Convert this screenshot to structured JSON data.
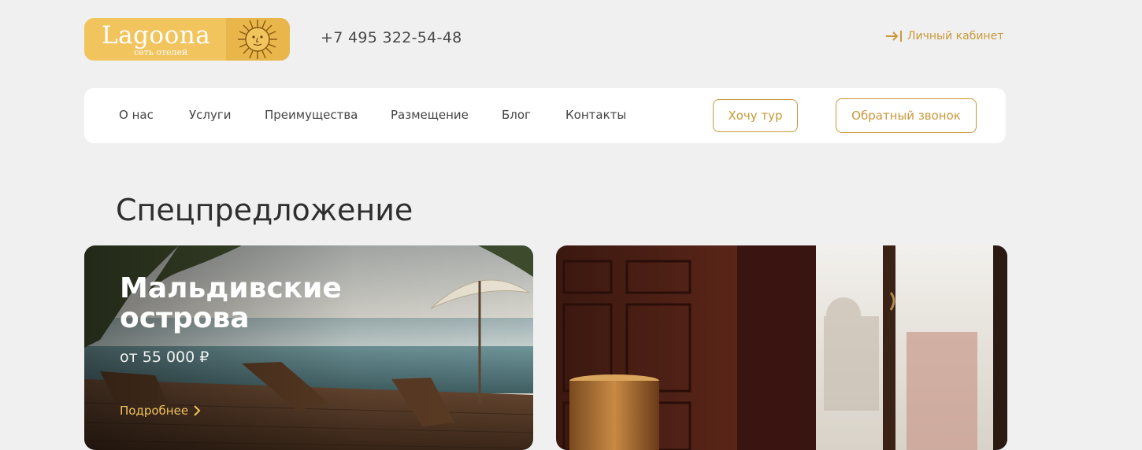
{
  "header": {
    "logo_text": "Lagoona",
    "logo_subtitle": "сеть отелей",
    "phone": "+7 495 322-54-48",
    "account_label": "Личный кабинет"
  },
  "nav": {
    "items": [
      {
        "label": "О нас"
      },
      {
        "label": "Услуги"
      },
      {
        "label": "Преимущества"
      },
      {
        "label": "Размещение"
      },
      {
        "label": "Блог"
      },
      {
        "label": "Контакты"
      }
    ],
    "tour_button": "Хочу тур",
    "callback_button": "Обратный звонок"
  },
  "special": {
    "title": "Спецпредложение",
    "cards": [
      {
        "title": "Мальдивские острова",
        "price": "от 55 000 ₽",
        "more": "Подробнее"
      }
    ]
  },
  "colors": {
    "accent": "#c9993a",
    "logo_bg": "#f2c45e",
    "page_bg": "#f0f0f0"
  }
}
